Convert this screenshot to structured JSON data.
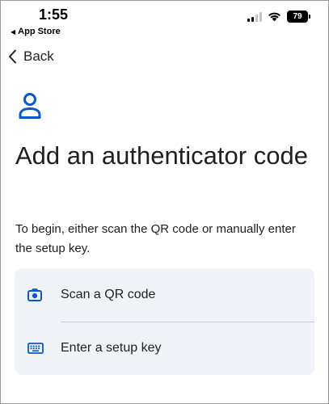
{
  "status_bar": {
    "time": "1:55",
    "back_app": "App Store",
    "battery": "79"
  },
  "nav": {
    "back_label": "Back"
  },
  "header": {
    "title": "Add an authenticator code",
    "description": "To begin, either scan the QR code or manually enter the setup key."
  },
  "options": [
    {
      "label": "Scan a QR code",
      "icon": "camera-icon"
    },
    {
      "label": "Enter a setup key",
      "icon": "keyboard-icon"
    }
  ],
  "colors": {
    "accent": "#0b57d0",
    "card_background": "#f0f4f9",
    "text": "#1f1f1f"
  }
}
